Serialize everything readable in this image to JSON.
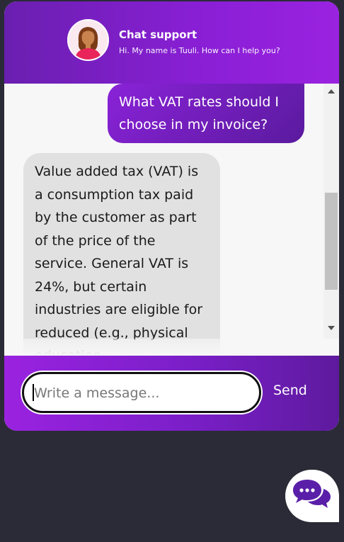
{
  "header": {
    "title": "Chat support",
    "subtitle": "Hi. My name is Tuuli. How can I help you?"
  },
  "messages": [
    {
      "from": "user",
      "text": "What VAT rates should I choose in my invoice?"
    },
    {
      "from": "bot",
      "text": "Value added tax (VAT) is a consumption tax paid by the customer as part of the price of the service. General VAT is 24%, but certain industries are eligible for reduced (e.g., physical education"
    }
  ],
  "composer": {
    "placeholder": "Write a message...",
    "value": "",
    "send_label": "Send"
  },
  "icons": {
    "avatar": "agent-avatar",
    "launcher": "chat-bubbles-icon"
  },
  "colors": {
    "page_bg": "#2b2b37",
    "accent_purple": "#8a1fd6",
    "accent_dark": "#5e1a9e",
    "bot_bubble": "#e1e1e1"
  }
}
